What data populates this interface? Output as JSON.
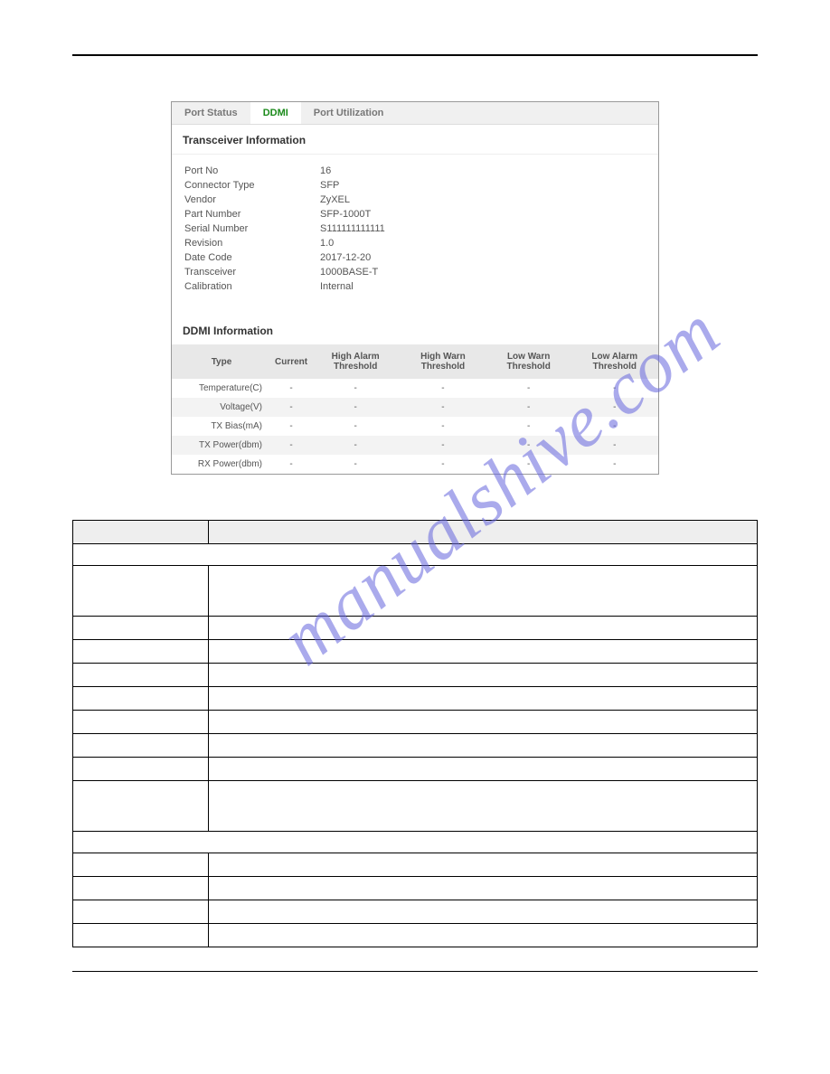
{
  "tabs": [
    "Port Status",
    "DDMI",
    "Port Utilization"
  ],
  "sections": {
    "transceiver_title": "Transceiver Information",
    "ddmi_title": "DDMI Information"
  },
  "transceiver": [
    {
      "label": "Port No",
      "value": "16"
    },
    {
      "label": "Connector Type",
      "value": "SFP"
    },
    {
      "label": "Vendor",
      "value": "ZyXEL"
    },
    {
      "label": "Part Number",
      "value": "SFP-1000T"
    },
    {
      "label": "Serial Number",
      "value": "S111111111111"
    },
    {
      "label": "Revision",
      "value": "1.0"
    },
    {
      "label": "Date Code",
      "value": "2017-12-20"
    },
    {
      "label": "Transceiver",
      "value": "1000BASE-T"
    },
    {
      "label": "Calibration",
      "value": "Internal"
    }
  ],
  "ddmi_headers": [
    "Type",
    "Current",
    "High Alarm Threshold",
    "High Warn Threshold",
    "Low Warn Threshold",
    "Low Alarm Threshold"
  ],
  "ddmi_rows": [
    {
      "type": "Temperature(C)",
      "v": [
        "-",
        "-",
        "-",
        "-",
        "-"
      ]
    },
    {
      "type": "Voltage(V)",
      "v": [
        "-",
        "-",
        "-",
        "-",
        "-"
      ]
    },
    {
      "type": "TX Bias(mA)",
      "v": [
        "-",
        "-",
        "-",
        "-",
        "-"
      ]
    },
    {
      "type": "TX Power(dbm)",
      "v": [
        "-",
        "-",
        "-",
        "-",
        "-"
      ]
    },
    {
      "type": "RX Power(dbm)",
      "v": [
        "-",
        "-",
        "-",
        "-",
        "-"
      ]
    }
  ],
  "watermark": "manualshive.com"
}
